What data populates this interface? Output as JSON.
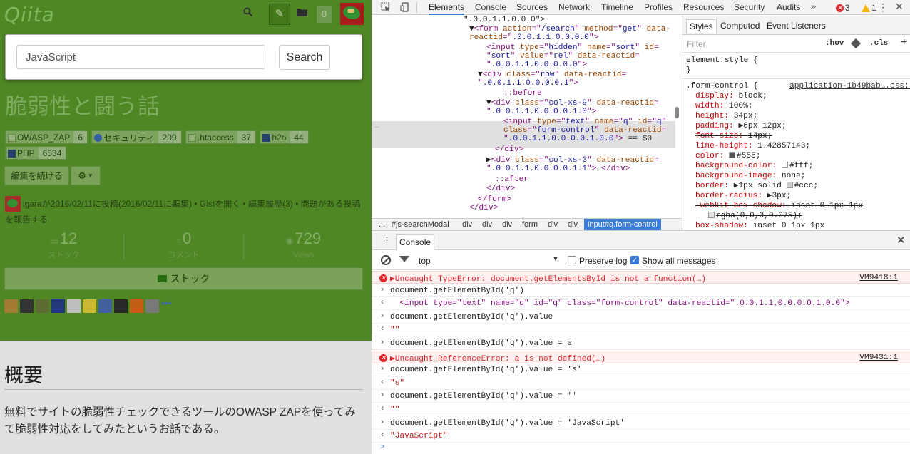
{
  "qiita": {
    "logo": "Qiita",
    "notif_count": "0",
    "search_modal": {
      "value": "JavaScript",
      "button": "Search"
    },
    "title": "脆弱性と闘う話",
    "tags": [
      {
        "name": "OWASP_ZAP",
        "count": "6"
      },
      {
        "name": "セキュリティ",
        "count": "209"
      },
      {
        "name": ".htaccess",
        "count": "37"
      },
      {
        "name": "h2o",
        "count": "44"
      },
      {
        "name": "PHP",
        "count": "6534"
      }
    ],
    "edit_button": "編集を続ける",
    "meta_text": "igaraが2016/02/11に投稿(2016/02/11に編集) • Gistを開く • 編集履歴(3) • 問題がある投稿を報告する",
    "stats": [
      {
        "num": "12",
        "label": "ストック"
      },
      {
        "num": "0",
        "label": "コメント"
      },
      {
        "num": "729",
        "label": "Views"
      }
    ],
    "stock_button": "ストック",
    "more_users": "•••",
    "heading": "概要",
    "body": "無料でサイトの脆弱性チェックできるツールのOWASP ZAPを使ってみて脆弱性対応をしてみたというお話である。"
  },
  "devtools": {
    "tabs": [
      "Elements",
      "Console",
      "Sources",
      "Network",
      "Timeline",
      "Profiles",
      "Resources",
      "Security",
      "Audits"
    ],
    "more": "»",
    "errors": "3",
    "warnings": "1",
    "elements": [
      {
        "i": 0,
        "parts": [
          [
            "tx",
            "\".0.0.1.1.0.0.0\">"
          ]
        ]
      },
      {
        "i": 1,
        "parts": [
          [
            "tx",
            "▼"
          ],
          [
            "tg",
            "<form "
          ],
          [
            "at",
            "action"
          ],
          [
            "tg",
            "=\""
          ],
          [
            "av",
            "/search"
          ],
          [
            "tg",
            "\" "
          ],
          [
            "at",
            "method"
          ],
          [
            "tg",
            "=\""
          ],
          [
            "av",
            "get"
          ],
          [
            "tg",
            "\" "
          ],
          [
            "at",
            "data-"
          ]
        ]
      },
      {
        "i": 2,
        "parts": [
          [
            "at",
            "reactid"
          ],
          [
            "tg",
            "=\""
          ],
          [
            "av",
            ".0.0.1.1.0.0.0.0"
          ],
          [
            "tg",
            "\">"
          ]
        ]
      },
      {
        "i": 3,
        "parts": [
          [
            "tg",
            "<input "
          ],
          [
            "at",
            "type"
          ],
          [
            "tg",
            "=\""
          ],
          [
            "av",
            "hidden"
          ],
          [
            "tg",
            "\" "
          ],
          [
            "at",
            "name"
          ],
          [
            "tg",
            "=\""
          ],
          [
            "av",
            "sort"
          ],
          [
            "tg",
            "\" "
          ],
          [
            "at",
            "id"
          ],
          [
            "tg",
            "="
          ]
        ]
      },
      {
        "i": 4,
        "parts": [
          [
            "tg",
            "\""
          ],
          [
            "av",
            "sort"
          ],
          [
            "tg",
            "\" "
          ],
          [
            "at",
            "value"
          ],
          [
            "tg",
            "=\""
          ],
          [
            "av",
            "rel"
          ],
          [
            "tg",
            "\" "
          ],
          [
            "at",
            "data-reactid"
          ],
          [
            "tg",
            "="
          ]
        ]
      },
      {
        "i": 5,
        "parts": [
          [
            "tg",
            "\""
          ],
          [
            "av",
            ".0.0.1.1.0.0.0.0.0"
          ],
          [
            "tg",
            "\">"
          ]
        ]
      },
      {
        "i": 6,
        "parts": [
          [
            "tx",
            "▼"
          ],
          [
            "tg",
            "<div "
          ],
          [
            "at",
            "class"
          ],
          [
            "tg",
            "=\""
          ],
          [
            "av",
            "row"
          ],
          [
            "tg",
            "\" "
          ],
          [
            "at",
            "data-reactid"
          ],
          [
            "tg",
            "="
          ]
        ]
      },
      {
        "i": 7,
        "parts": [
          [
            "tg",
            "\""
          ],
          [
            "av",
            ".0.0.1.1.0.0.0.0.1"
          ],
          [
            "tg",
            "\">"
          ]
        ]
      },
      {
        "i": 8,
        "parts": [
          [
            "tg",
            "::before"
          ]
        ]
      },
      {
        "i": 9,
        "parts": [
          [
            "tx",
            "▼"
          ],
          [
            "tg",
            "<div "
          ],
          [
            "at",
            "class"
          ],
          [
            "tg",
            "=\""
          ],
          [
            "av",
            "col-xs-9"
          ],
          [
            "tg",
            "\" "
          ],
          [
            "at",
            "data-reactid"
          ],
          [
            "tg",
            "="
          ]
        ]
      },
      {
        "i": 10,
        "parts": [
          [
            "tg",
            "\""
          ],
          [
            "av",
            ".0.0.1.1.0.0.0.0.1.0"
          ],
          [
            "tg",
            "\">"
          ]
        ]
      },
      {
        "i": 11,
        "parts": [
          [
            "tg",
            "<input "
          ],
          [
            "at",
            "type"
          ],
          [
            "tg",
            "=\""
          ],
          [
            "av",
            "text"
          ],
          [
            "tg",
            "\" "
          ],
          [
            "at",
            "name"
          ],
          [
            "tg",
            "=\""
          ],
          [
            "av",
            "q"
          ],
          [
            "tg",
            "\" "
          ],
          [
            "at",
            "id"
          ],
          [
            "tg",
            "=\""
          ],
          [
            "av",
            "q"
          ],
          [
            "tg",
            "\""
          ]
        ]
      },
      {
        "i": 12,
        "parts": [
          [
            "at",
            "class"
          ],
          [
            "tg",
            "=\""
          ],
          [
            "av",
            "form-control"
          ],
          [
            "tg",
            "\" "
          ],
          [
            "at",
            "data-reactid"
          ],
          [
            "tg",
            "="
          ]
        ]
      },
      {
        "i": 13,
        "parts": [
          [
            "tg",
            "\""
          ],
          [
            "av",
            ".0.0.1.1.0.0.0.0.1.0.0"
          ],
          [
            "tg",
            "\">"
          ],
          [
            "tx",
            " == $0"
          ]
        ]
      },
      {
        "i": 14,
        "parts": [
          [
            "tg",
            "</div>"
          ]
        ]
      },
      {
        "i": 15,
        "parts": [
          [
            "tx",
            "▶"
          ],
          [
            "tg",
            "<div "
          ],
          [
            "at",
            "class"
          ],
          [
            "tg",
            "=\""
          ],
          [
            "av",
            "col-xs-3"
          ],
          [
            "tg",
            "\" "
          ],
          [
            "at",
            "data-reactid"
          ],
          [
            "tg",
            "="
          ]
        ]
      },
      {
        "i": 16,
        "parts": [
          [
            "tg",
            "\""
          ],
          [
            "av",
            ".0.0.1.1.0.0.0.0.1.1"
          ],
          [
            "tg",
            "\">"
          ],
          [
            "tx",
            "…"
          ],
          [
            "tg",
            "</div>"
          ]
        ]
      },
      {
        "i": 17,
        "parts": [
          [
            "tg",
            "::after"
          ]
        ]
      },
      {
        "i": 18,
        "parts": [
          [
            "tg",
            "</div>"
          ]
        ]
      },
      {
        "i": 19,
        "parts": [
          [
            "tg",
            "</form>"
          ]
        ]
      },
      {
        "i": 20,
        "parts": [
          [
            "tg",
            "</div>"
          ]
        ]
      }
    ],
    "breadcrumbs": [
      "...",
      "#js-searchModal",
      "div",
      "div",
      "div",
      "form",
      "div",
      "div",
      "input#q.form-control"
    ],
    "styles_tabs": [
      "Styles",
      "Computed",
      "Event Listeners"
    ],
    "filter_placeholder": "Filter",
    "hov": ":hov",
    "cls": ".cls",
    "element_style": [
      "element.style {",
      "}"
    ],
    "rule_selector": ".form-control {",
    "rule_source": "application-1b49bab….css:4",
    "rule_props": [
      {
        "n": "display",
        "v": "block;"
      },
      {
        "n": "width",
        "v": "100%;"
      },
      {
        "n": "height",
        "v": "34px;"
      },
      {
        "n": "padding",
        "v": "▶6px 12px;"
      },
      {
        "n": "font-size",
        "v": "14px;",
        "strike": true
      },
      {
        "n": "line-height",
        "v": "1.42857143;"
      },
      {
        "n": "color",
        "v": "#555;",
        "sw": "#555555"
      },
      {
        "n": "background-color",
        "v": "#fff;",
        "sw": "#ffffff"
      },
      {
        "n": "background-image",
        "v": "none;"
      },
      {
        "n": "border",
        "v": "▶1px solid ",
        "sw2": "#cccccc",
        "v2": "#ccc;"
      },
      {
        "n": "border-radius",
        "v": "▶3px;"
      },
      {
        "n": "-webkit-box-shadow",
        "v": "inset 0 1px 1px",
        "strike": true
      },
      {
        "n": "",
        "v": "rgba(0,0,0,0.075);",
        "strike": true,
        "sw": "#dddddd",
        "indent": true
      },
      {
        "n": "box-shadow",
        "v": "inset 0 1px 1px"
      }
    ],
    "console_tab": "Console",
    "context": "top",
    "preserve_log": "Preserve log",
    "show_all": "Show all messages",
    "console": [
      {
        "kind": "err",
        "text": "▶Uncaught TypeError: document.getElementsById is not a function(…)",
        "src": "VM9418:1"
      },
      {
        "kind": "in",
        "text": "document.getElementById('q')"
      },
      {
        "kind": "out",
        "text": "  <input type=\"text\" name=\"q\" id=\"q\" class=\"form-control\" data-reactid=\".0.0.1.1.0.0.0.0.1.0.0\">"
      },
      {
        "kind": "in",
        "text": "document.getElementById('q').value"
      },
      {
        "kind": "out",
        "text": "\"\""
      },
      {
        "kind": "in",
        "text": "document.getElementById('q').value = a"
      },
      {
        "kind": "err",
        "text": "▶Uncaught ReferenceError: a is not defined(…)",
        "src": "VM9431:1"
      },
      {
        "kind": "in",
        "text": "document.getElementById('q').value = 's'"
      },
      {
        "kind": "out",
        "text": "\"s\""
      },
      {
        "kind": "in",
        "text": "document.getElementById('q').value = ''"
      },
      {
        "kind": "out",
        "text": "\"\""
      },
      {
        "kind": "in",
        "text": "document.getElementById('q').value = 'JavaScript'"
      },
      {
        "kind": "out",
        "text": "\"JavaScript\""
      }
    ],
    "prompt": ">"
  },
  "colors": {
    "qiita_green": "#5a9a2a",
    "devtools_blue": "#3879d9",
    "error_red": "#e0262a"
  }
}
